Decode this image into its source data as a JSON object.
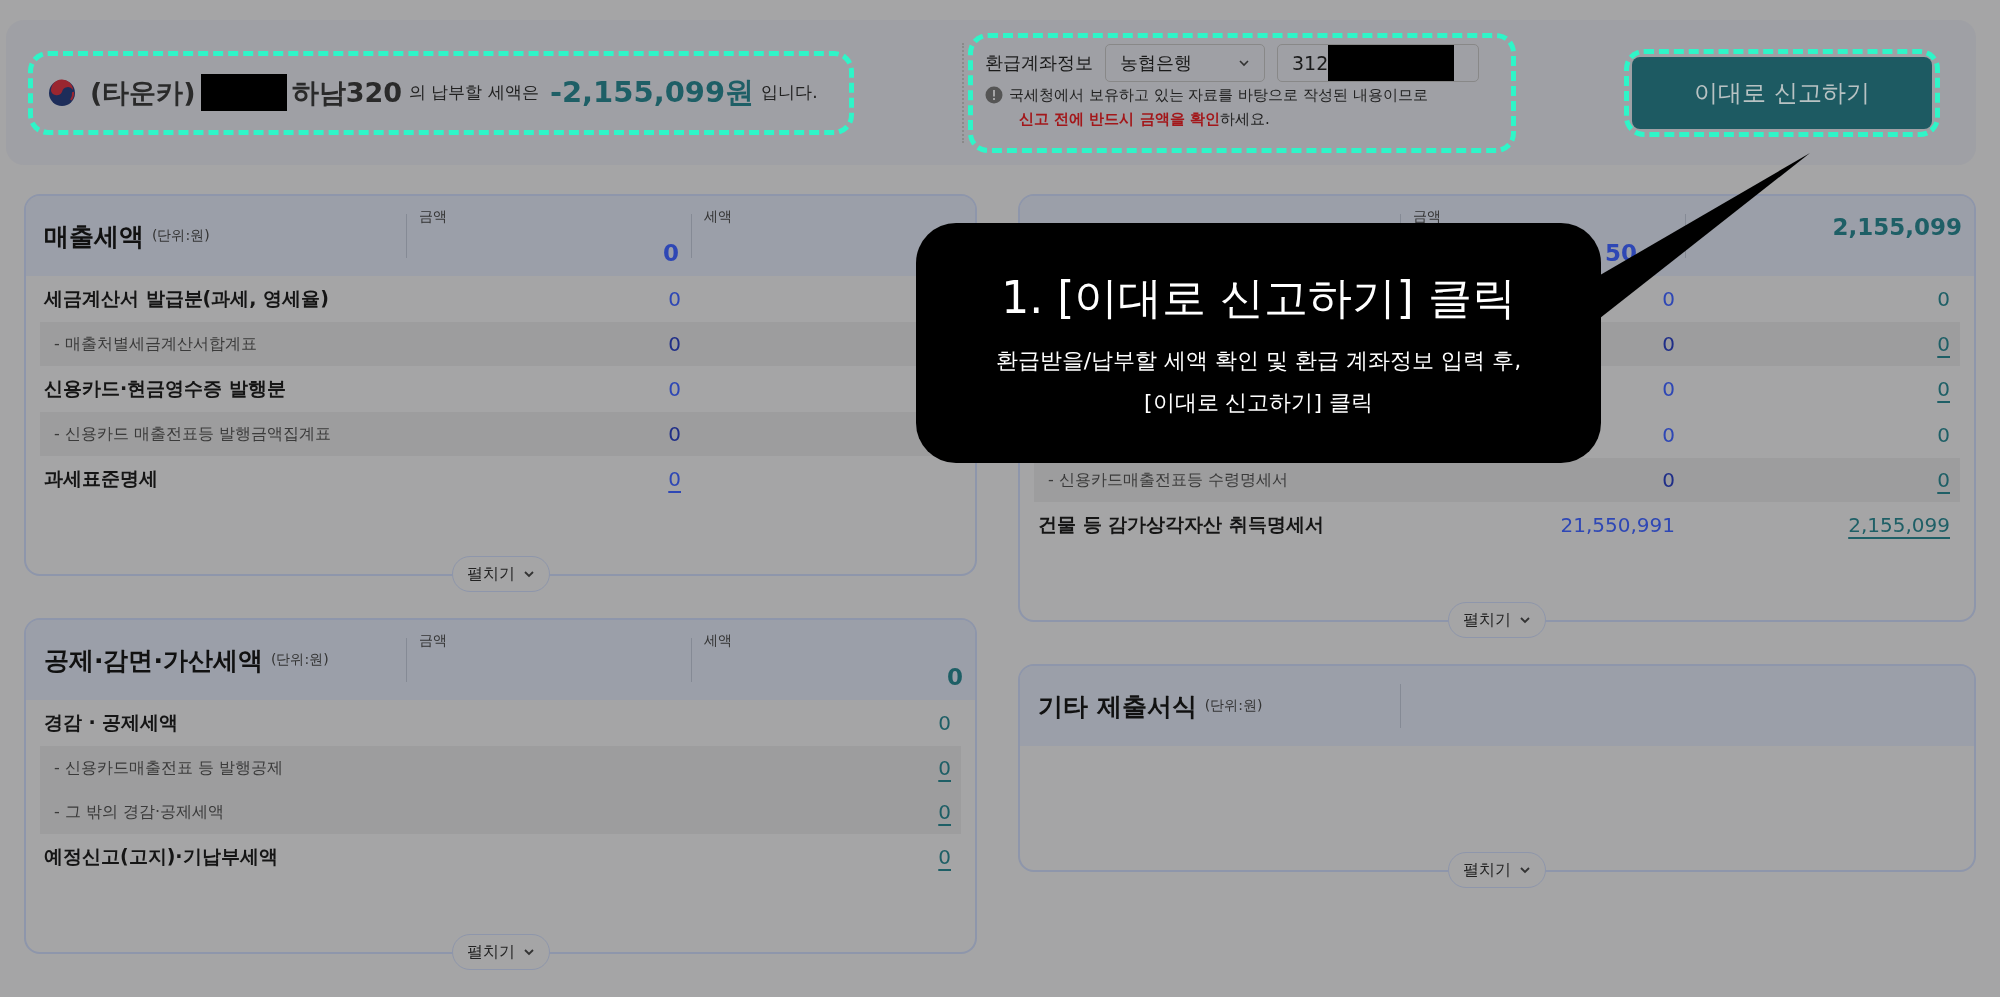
{
  "header": {
    "name_prefix": "(타운카)",
    "name_suffix": "하남320",
    "label": "의 납부할 세액은",
    "amount": "-2,155,099원",
    "ending": "입니다.",
    "highlighted": true
  },
  "refund_account": {
    "label": "환급계좌정보",
    "bank": "농협은행",
    "account_prefix": "312",
    "notice": "국세청에서 보유하고 있는 자료를 바탕으로 작성된 내용이므로",
    "warning": "신고 전에 반드시 금액을 확인",
    "warning_suffix": "하세요.",
    "highlighted": true
  },
  "submit_button": {
    "label": "이대로 신고하기",
    "highlighted": true
  },
  "columns": [
    {
      "panels": [
        {
          "title": "매출세액",
          "unit": "(단위:원)",
          "amount_header": "금액",
          "tax_header": "세액",
          "total_amount": "0",
          "rows": [
            {
              "kind": "main",
              "label": "세금계산서 발급분(과세, 영세율)",
              "amount": "0",
              "amount_underlined": false
            },
            {
              "kind": "sub",
              "label": "- 매출처별세금계산서합계표",
              "amount": "0",
              "amount_underlined": false
            },
            {
              "kind": "main",
              "label": "신용카드·현금영수증 발행분",
              "amount": "0",
              "amount_underlined": false
            },
            {
              "kind": "sub",
              "label": "- 신용카드 매출전표등 발행금액집계표",
              "amount": "0",
              "amount_underlined": false
            },
            {
              "kind": "main",
              "label": "과세표준명세",
              "amount": "0",
              "amount_underlined": true
            }
          ],
          "expand_label": "펼치기"
        },
        {
          "title": "공제·감면·가산세액",
          "unit": "(단위:원)",
          "amount_header": "금액",
          "tax_header": "세액",
          "total_tax": "0",
          "rows": [
            {
              "kind": "main",
              "label": "경감 · 공제세액",
              "tax": "0",
              "tax_underlined": false
            },
            {
              "kind": "sub",
              "label": "- 신용카드매출전표 등 발행공제",
              "tax": "0",
              "tax_underlined": true
            },
            {
              "kind": "sub",
              "label": "- 그 밖의 경감·공제세액",
              "tax": "0",
              "tax_underlined": true
            },
            {
              "kind": "main",
              "label": "예정신고(고지)·기납부세액",
              "tax": "0",
              "tax_underlined": true
            }
          ],
          "expand_label": "펼치기"
        }
      ]
    },
    {
      "panels": [
        {
          "amount_header": "금액",
          "total_amount": "50",
          "total_tax": "2,155,099",
          "rows": [
            {
              "kind": "main",
              "amount": "0",
              "amount_underlined": false,
              "tax": "0",
              "tax_underlined": false
            },
            {
              "kind": "sub",
              "amount": "0",
              "amount_underlined": false,
              "tax": "0",
              "tax_underlined": true
            },
            {
              "kind": "main",
              "amount": "0",
              "amount_underlined": false,
              "tax": "0",
              "tax_underlined": true
            },
            {
              "kind": "main",
              "amount": "0",
              "amount_underlined": false,
              "tax": "0",
              "tax_underlined": false
            },
            {
              "kind": "sub",
              "label": "- 신용카드매출전표등 수령명세서",
              "amount": "0",
              "amount_underlined": false,
              "tax": "0",
              "tax_underlined": true
            },
            {
              "kind": "main",
              "label": "건물 등 감가상각자산 취득명세서",
              "amount": "21,550,991",
              "amount_underlined": false,
              "tax": "2,155,099",
              "tax_underlined": true
            }
          ],
          "expand_label": "펼치기"
        },
        {
          "title": "기타 제출서식",
          "unit": "(단위:원)",
          "expand_label": "펼치기"
        }
      ]
    }
  ],
  "callout": {
    "title": "1. [이대로 신고하기] 클릭",
    "lines": [
      "환급받을/납부할 세액 확인 및 환급 계좌정보 입력 후,",
      "[이대로 신고하기] 클릭"
    ]
  }
}
